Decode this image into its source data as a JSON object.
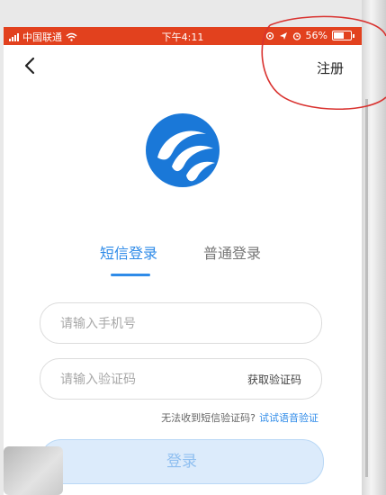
{
  "status_bar": {
    "carrier": "中国联通",
    "time": "下午4:11",
    "battery": "56%",
    "icons": [
      "signal-icon",
      "wifi-icon",
      "location-icon",
      "alarm-icon",
      "battery-icon"
    ]
  },
  "nav": {
    "back_icon": "back-arrow-icon",
    "register_label": "注册"
  },
  "logo": {
    "icon": "app-logo-icon",
    "color": "#1a78d8"
  },
  "tabs": [
    {
      "label": "短信登录",
      "active": true
    },
    {
      "label": "普通登录",
      "active": false
    }
  ],
  "form": {
    "phone_placeholder": "请输入手机号",
    "code_placeholder": "请输入验证码",
    "get_code_label": "获取验证码"
  },
  "hint": {
    "text": "无法收到短信验证码?",
    "voice_link": "试试语音验证"
  },
  "login_button": "登录",
  "colors": {
    "status_bar": "#e2411e",
    "accent": "#2f8be8",
    "annotation": "#d9322f"
  }
}
